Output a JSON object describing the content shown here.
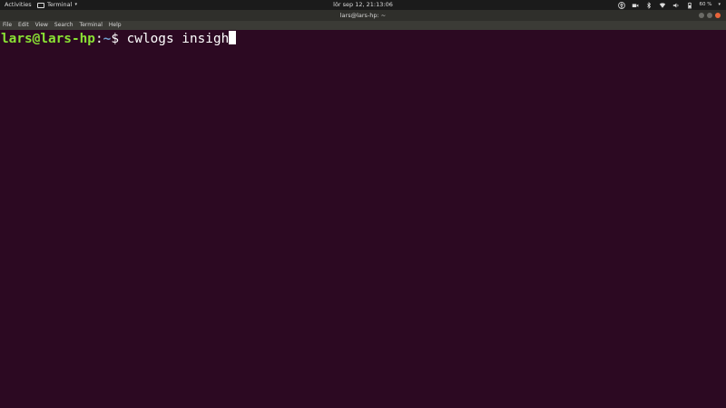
{
  "topbar": {
    "activities": "Activities",
    "app_menu": "Terminal",
    "clock": "lör sep 12, 21:13:06",
    "battery_pct": "60 %",
    "icons": [
      "accessibility-icon",
      "video-icon",
      "bluetooth-icon",
      "wifi-icon",
      "volume-icon",
      "battery-icon",
      "system-menu-caret-icon"
    ]
  },
  "window": {
    "title": "lars@lars-hp: ~"
  },
  "menubar": {
    "items": [
      "File",
      "Edit",
      "View",
      "Search",
      "Terminal",
      "Help"
    ]
  },
  "terminal": {
    "user_host": "lars@lars-hp",
    "sep": ":",
    "path": "~",
    "dollar": "$ ",
    "command": "cwlogs insigh"
  },
  "colors": {
    "terminal_bg": "#2c0922",
    "prompt_user": "#8ae234",
    "prompt_path": "#729fcf",
    "topbar_bg": "#1b1b1b",
    "close_button": "#e9643a"
  }
}
